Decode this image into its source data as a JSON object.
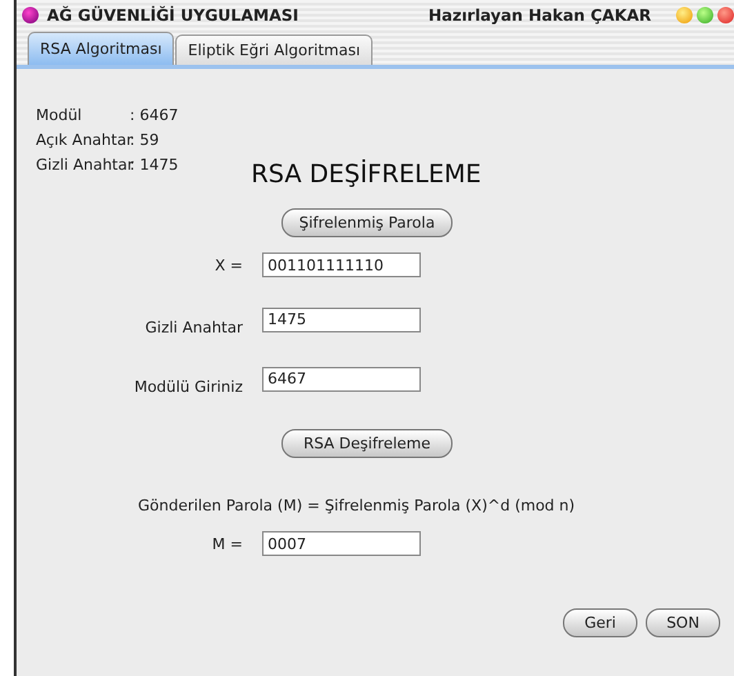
{
  "window": {
    "title": "AĞ GÜVENLİĞİ UYGULAMASI",
    "author": "Hazırlayan Hakan ÇAKAR"
  },
  "tabs": [
    {
      "label": "RSA Algoritması",
      "selected": true
    },
    {
      "label": "Eliptik Eğri Algoritması",
      "selected": false
    }
  ],
  "info": [
    {
      "label": "Modül",
      "value": ": 6467"
    },
    {
      "label": "Açık Anahtar",
      "value": ": 59"
    },
    {
      "label": "Gizli Anahtar",
      "value": ": 1475"
    }
  ],
  "heading": "RSA DEŞİFRELEME",
  "encrypted_button": "Şifrelenmiş Parola",
  "fields": [
    {
      "label": "X =",
      "value": "001101111110"
    },
    {
      "label": "Gizli Anahtar",
      "value": "1475"
    },
    {
      "label": "Modülü Giriniz",
      "value": "6467"
    }
  ],
  "decrypt_button": "RSA Deşifreleme",
  "formula": "Gönderilen Parola (M) = Şifrelenmiş Parola (X)^d (mod n)",
  "result": {
    "label": "M =",
    "value": "0007"
  },
  "footer_buttons": [
    "Geri",
    "SON"
  ]
}
